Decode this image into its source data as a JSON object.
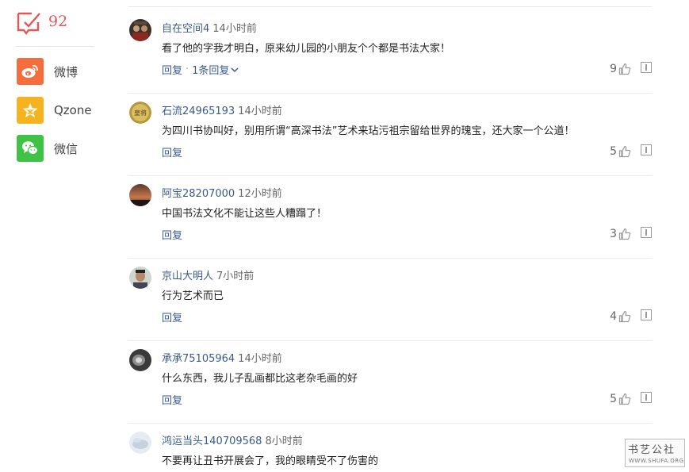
{
  "sidebar": {
    "comment_count": "92",
    "share": [
      {
        "label": "微博",
        "icon": "weibo-icon",
        "color": "#f36d3d"
      },
      {
        "label": "Qzone",
        "icon": "qzone-star-icon",
        "color": "#f5b41f"
      },
      {
        "label": "微信",
        "icon": "wechat-icon",
        "color": "#3fc246"
      }
    ]
  },
  "comments": [
    {
      "user": "自在空间4",
      "time": "14小时前",
      "text": "看了他的字我才明白，原来幼儿园的小朋友个个都是书法大家！",
      "reply": "回复",
      "sep": "·",
      "more_replies": "1条回复",
      "likes": "9"
    },
    {
      "user": "石流24965193",
      "time": "14小时前",
      "text": "为四川书协叫好，别用所谓“高深书法”艺术来玷污祖宗留给世界的瑰宝，还大家一个公道！",
      "reply": "回复",
      "likes": "5",
      "avatar_text": "皇将"
    },
    {
      "user": "阿宝28207000",
      "time": "12小时前",
      "text": "中国书法文化不能让这些人糟蹋了！",
      "reply": "回复",
      "likes": "3"
    },
    {
      "user": "京山大明人",
      "time": "7小时前",
      "text": "行为艺术而已",
      "reply": "回复",
      "likes": "4"
    },
    {
      "user": "承承75105964",
      "time": "14小时前",
      "text": "什么东西，我儿子乱画都比这老杂毛画的好",
      "reply": "回复",
      "likes": "5"
    },
    {
      "user": "鸿运当头140709568",
      "time": "8小时前",
      "text": "不要再让丑书开展会了，我的眼睛受不了伤害的"
    }
  ],
  "watermark": {
    "title": "书艺公社",
    "url": "WWW.SHUFA.ORG"
  },
  "colors": {
    "accent_red": "#e55757",
    "link_blue": "#3a5a8c"
  }
}
